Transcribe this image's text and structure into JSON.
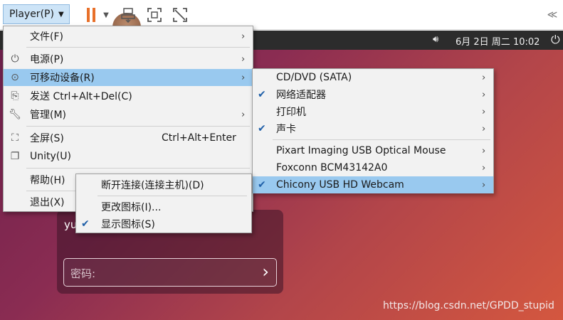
{
  "toolbar": {
    "player_label": "Player(P)",
    "icons": [
      "pause-icon",
      "send-keys-icon",
      "fullscreen-icon",
      "unity-icon",
      "collapse-icon"
    ]
  },
  "desktop": {
    "clock": "6月 2日 周二 10:02",
    "login_user": "yu",
    "password_placeholder": "密码:",
    "watermark": "https://blog.csdn.net/GPDD_stupid"
  },
  "main_menu": {
    "items": [
      {
        "label": "文件(F)",
        "has_sub": true
      },
      {
        "label": "电源(P)",
        "has_sub": true,
        "icon": "power-icon"
      },
      {
        "label": "可移动设备(R)",
        "has_sub": true,
        "icon": "removable-device-icon",
        "highlighted": true
      },
      {
        "label": "发送 Ctrl+Alt+Del(C)",
        "icon": "send-keys-icon"
      },
      {
        "label": "管理(M)",
        "has_sub": true,
        "icon": "wrench-icon"
      },
      {
        "label": "全屏(S)",
        "accel": "Ctrl+Alt+Enter",
        "icon": "fullscreen-icon"
      },
      {
        "label": "Unity(U)",
        "icon": "unity-icon"
      },
      {
        "label": "帮助(H)"
      },
      {
        "label": "退出(X)"
      }
    ]
  },
  "device_menu": {
    "items": [
      {
        "label": "CD/DVD (SATA)",
        "checked": false
      },
      {
        "label": "网络适配器",
        "checked": true
      },
      {
        "label": "打印机",
        "checked": false
      },
      {
        "label": "声卡",
        "checked": true
      },
      {
        "label": "Pixart Imaging USB Optical Mouse",
        "checked": false
      },
      {
        "label": "Foxconn BCM43142A0",
        "checked": false
      },
      {
        "label": "Chicony USB HD Webcam",
        "checked": true,
        "highlighted": true
      }
    ]
  },
  "webcam_menu": {
    "items": [
      {
        "label": "断开连接(连接主机)(D)"
      },
      {
        "label": "更改图标(I)..."
      },
      {
        "label": "显示图标(S)",
        "checked": true
      }
    ]
  },
  "glyphs": {
    "submenu": "›",
    "check": "✔"
  }
}
